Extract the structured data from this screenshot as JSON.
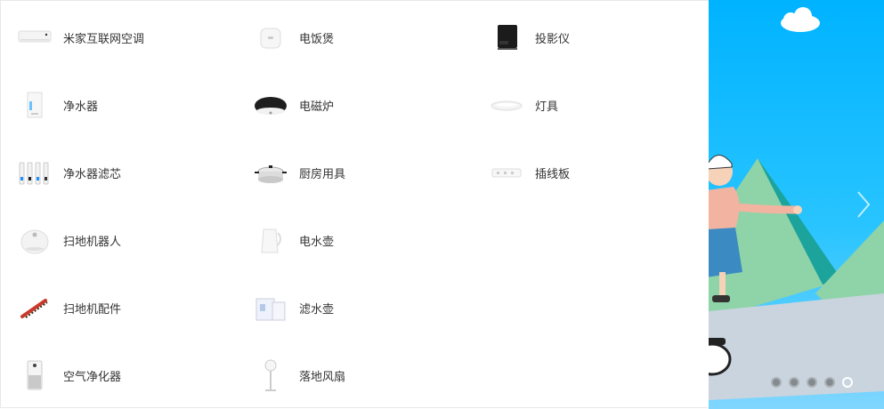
{
  "categories": {
    "col1": [
      {
        "label": "米家互联网空调",
        "icon": "air-conditioner-icon"
      },
      {
        "label": "净水器",
        "icon": "water-purifier-icon"
      },
      {
        "label": "净水器滤芯",
        "icon": "filter-cartridge-icon"
      },
      {
        "label": "扫地机器人",
        "icon": "robot-vacuum-icon"
      },
      {
        "label": "扫地机配件",
        "icon": "vacuum-brush-icon"
      },
      {
        "label": "空气净化器",
        "icon": "air-purifier-icon"
      }
    ],
    "col2": [
      {
        "label": "电饭煲",
        "icon": "rice-cooker-icon"
      },
      {
        "label": "电磁炉",
        "icon": "induction-cooker-icon"
      },
      {
        "label": "厨房用具",
        "icon": "cooking-pot-icon"
      },
      {
        "label": "电水壶",
        "icon": "electric-kettle-icon"
      },
      {
        "label": "滤水壶",
        "icon": "filter-pitcher-icon"
      },
      {
        "label": "落地风扇",
        "icon": "floor-fan-icon"
      }
    ],
    "col3": [
      {
        "label": "投影仪",
        "icon": "projector-icon"
      },
      {
        "label": "灯具",
        "icon": "ceiling-lamp-icon"
      },
      {
        "label": "插线板",
        "icon": "power-strip-icon"
      }
    ]
  },
  "banner": {
    "slide_count": 5,
    "active_index": 4,
    "colors": {
      "sky_top": "#00b3ff",
      "sky_bottom": "#7fd6ff",
      "mountain": "#8fd3a8",
      "mountain_dark": "#1ba39c"
    }
  }
}
